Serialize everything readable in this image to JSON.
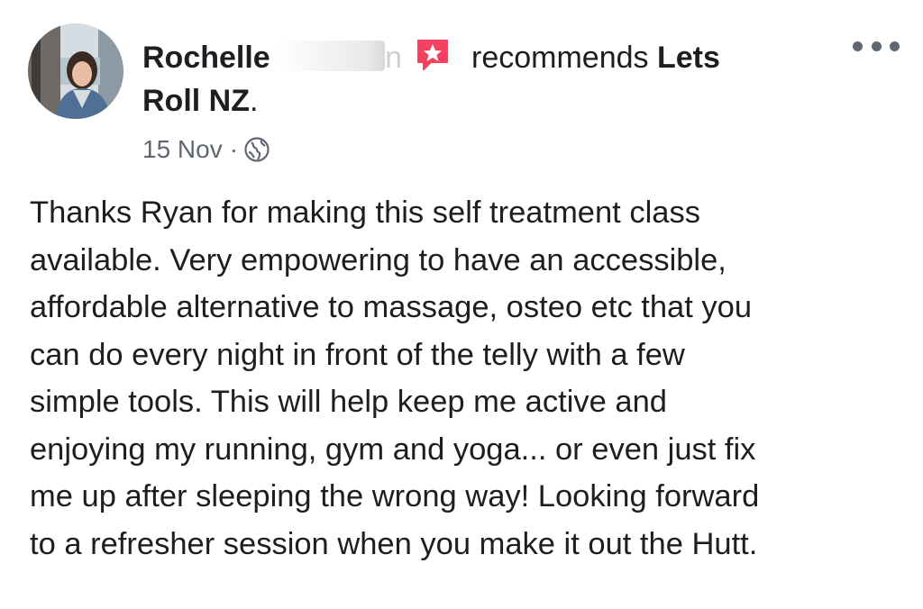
{
  "post": {
    "author": {
      "first_name": "Rochelle",
      "last_initial_partial": "n"
    },
    "action_verb": "recommends",
    "page_name": "Lets Roll NZ",
    "page_name_line1": "Lets",
    "page_name_line2": "Roll NZ",
    "trailing_punct": ".",
    "date": "15 Nov",
    "separator": "·",
    "privacy_icon": "globe-icon",
    "recommend_icon": "recommendation-star-icon",
    "more_icon": "more-options-icon",
    "accent_color": "#f3425f",
    "body_lines": [
      "Thanks Ryan for making this self treatment class",
      "available. Very empowering to have an accessible,",
      "affordable alternative to massage, osteo etc that you",
      "can do every night in front of the telly with a few",
      "simple tools. This will help keep me active and",
      "enjoying my running, gym and yoga... or even just fix",
      "me up after sleeping the wrong way! Looking forward",
      "to a refresher session when you make it out the Hutt."
    ]
  }
}
